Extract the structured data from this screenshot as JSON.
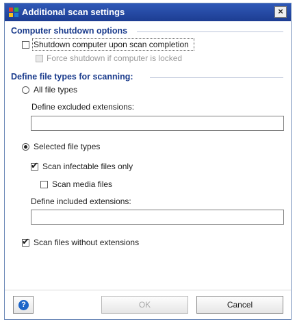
{
  "window": {
    "title": "Additional scan settings",
    "close_label": "×"
  },
  "shutdown": {
    "heading": "Computer shutdown options",
    "shutdown_on_completion": {
      "label": "Shutdown computer upon scan completion",
      "checked": false
    },
    "force_shutdown": {
      "label": "Force shutdown if computer is locked",
      "checked": false,
      "enabled": false
    }
  },
  "file_types": {
    "heading": "Define file types for scanning:",
    "all_types": {
      "label": "All file types",
      "selected": false
    },
    "excluded_label": "Define excluded extensions:",
    "excluded_value": "",
    "selected_types": {
      "label": "Selected file types",
      "selected": true
    },
    "infectable_only": {
      "label": "Scan infectable files only",
      "checked": true
    },
    "media_files": {
      "label": "Scan media files",
      "checked": false
    },
    "included_label": "Define included extensions:",
    "included_value": "",
    "without_extensions": {
      "label": "Scan files without extensions",
      "checked": true
    }
  },
  "buttons": {
    "help_glyph": "?",
    "ok_label": "OK",
    "cancel_label": "Cancel"
  },
  "colors": {
    "titlebar": "#1d3d92",
    "heading": "#1a3b8c",
    "help_icon": "#1d65c8"
  }
}
